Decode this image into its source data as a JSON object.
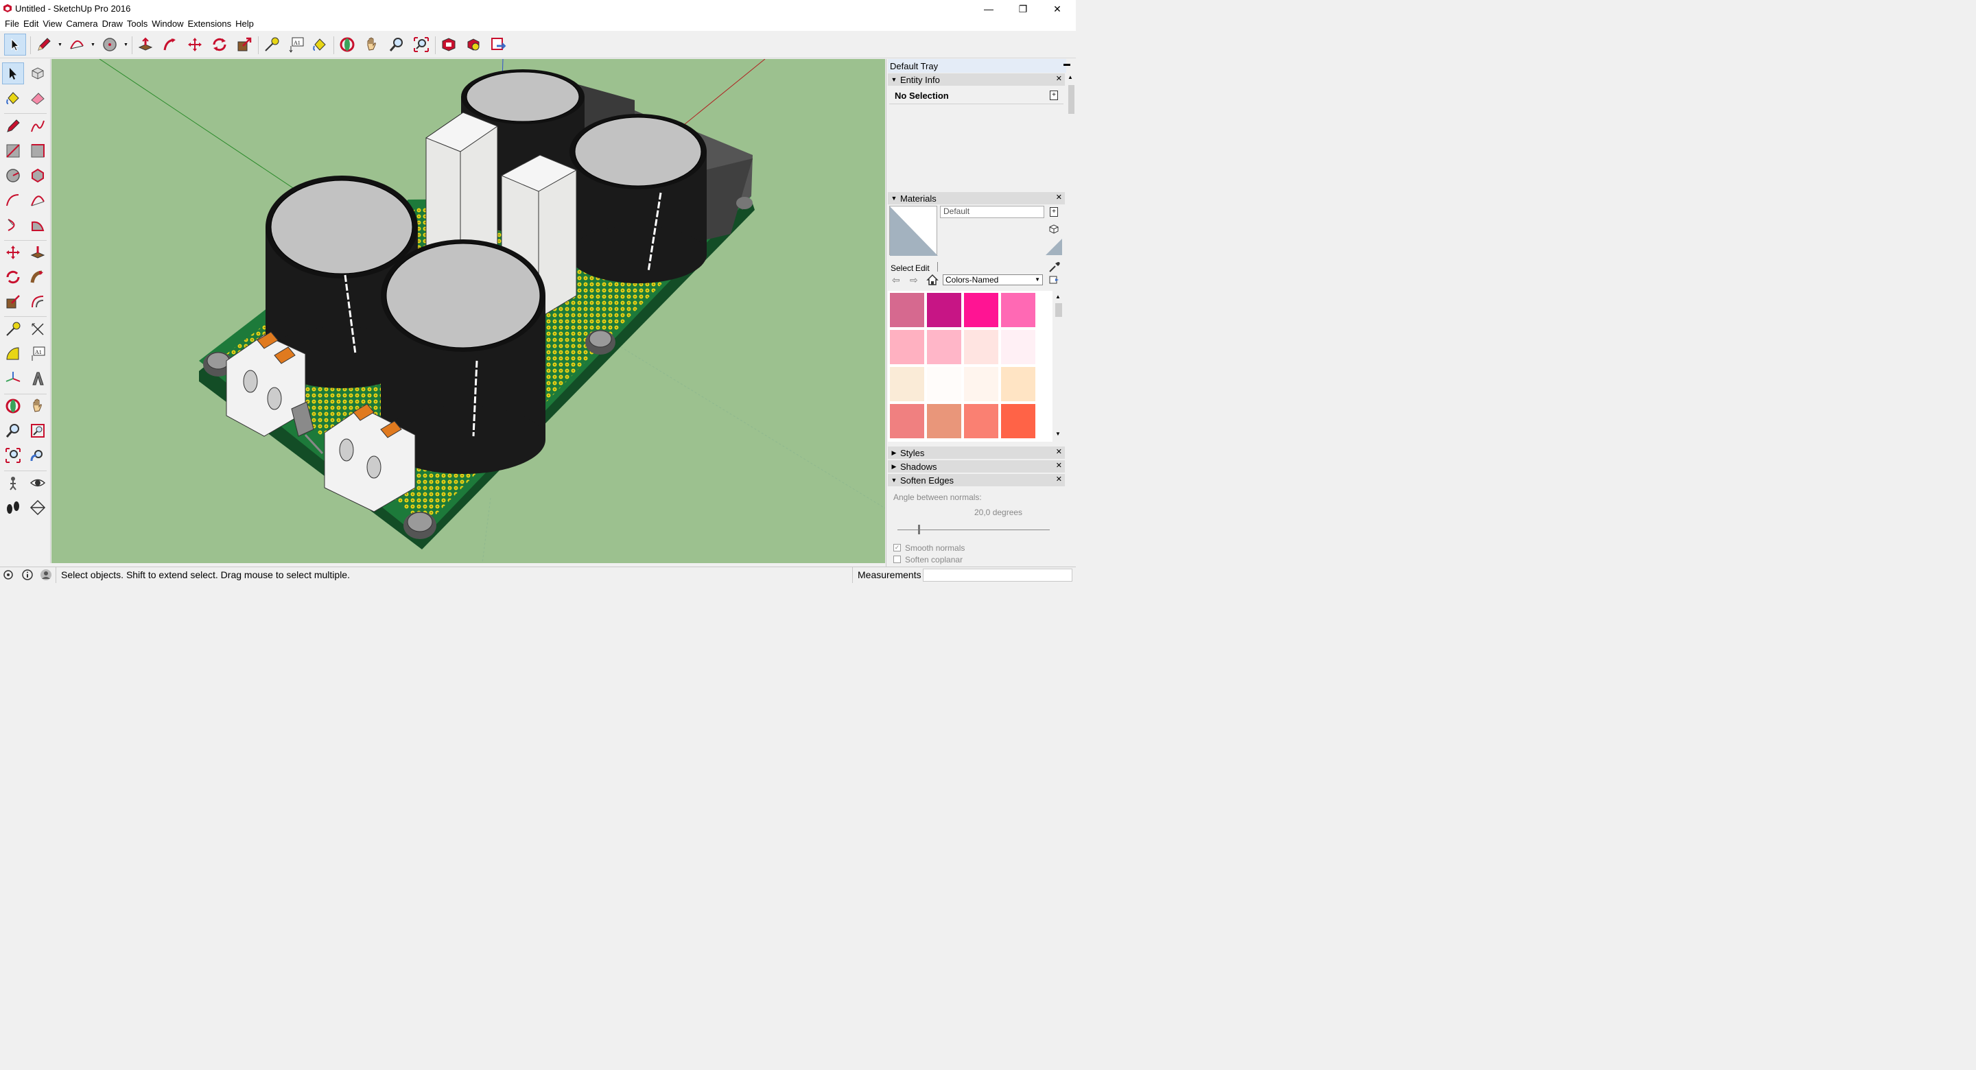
{
  "window": {
    "title": "Untitled - SketchUp Pro 2016",
    "minimize": "—",
    "restore": "❐",
    "close": "✕"
  },
  "menu": [
    "File",
    "Edit",
    "View",
    "Camera",
    "Draw",
    "Tools",
    "Window",
    "Extensions",
    "Help"
  ],
  "tray": {
    "title": "Default Tray",
    "entity_info": {
      "header": "Entity Info",
      "selection": "No Selection"
    },
    "materials": {
      "header": "Materials",
      "material_name": "Default",
      "tab_select": "Select",
      "tab_edit": "Edit",
      "library": "Colors-Named",
      "swatches": [
        "#d6698f",
        "#c71585",
        "#ff1493",
        "#ff69b4",
        "#ffb1c1",
        "#ffb6c8",
        "#ffe4e1",
        "#fff0f5",
        "#faebd7",
        "#fffcfa",
        "#fff5ee",
        "#ffe4c4",
        "#f08080",
        "#e9967a",
        "#fa8072",
        "#ff6347"
      ]
    },
    "styles": "Styles",
    "shadows": "Shadows",
    "soften_edges": {
      "header": "Soften Edges",
      "angle_label": "Angle between normals:",
      "angle_value": "20,0  degrees",
      "smooth_normals": "Smooth normals",
      "soften_coplanar": "Soften coplanar"
    }
  },
  "status": {
    "hint": "Select objects. Shift to extend select. Drag mouse to select multiple.",
    "measurements": "Measurements"
  },
  "colors": {
    "viewport_bg": "#9cc18f",
    "pcb": "#1d7a3a",
    "pad": "#e8d615",
    "capacitor": "#1a1a1a",
    "cap_top": "#c2c2c2"
  }
}
